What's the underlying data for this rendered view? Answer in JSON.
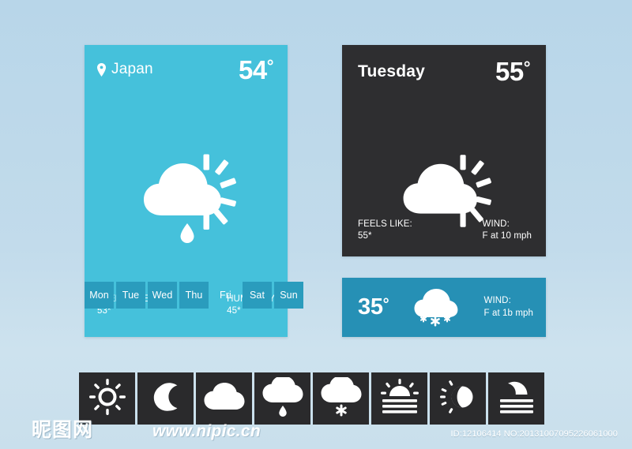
{
  "background": {
    "top_color": "#b8d6e9",
    "bottom_color": "#cde2ee"
  },
  "main_card": {
    "accent_color": "#45c1db",
    "location_icon": "location-pin-icon",
    "location": "Japan",
    "temperature": "54",
    "degree": "°",
    "weather_icon": "cloud-sun-rain-icon",
    "feels_like_label": "FEELS LIKE:",
    "feels_like_value": "53*",
    "humidity_label": "HUMANITY",
    "humidity_value": "45*",
    "days": [
      {
        "label": "Mon",
        "selected": false
      },
      {
        "label": "Tue",
        "selected": false
      },
      {
        "label": "Wed",
        "selected": false
      },
      {
        "label": "Thu",
        "selected": false
      },
      {
        "label": "Fri",
        "selected": true
      },
      {
        "label": "Sat",
        "selected": false
      },
      {
        "label": "Sun",
        "selected": false
      }
    ]
  },
  "dark_card": {
    "accent_color": "#2e2e30",
    "day": "Tuesday",
    "temperature": "55",
    "degree": "°",
    "weather_icon": "cloud-sun-icon",
    "feels_like_label": "FEELS LIKE:",
    "feels_like_value": "55*",
    "wind_label": "WIND:",
    "wind_value": "F at 10 mph"
  },
  "teal_card": {
    "accent_color": "#2690b5",
    "temperature": "35",
    "degree": "°",
    "weather_icon": "cloud-snow-icon",
    "wind_label": "WIND:",
    "wind_value": "F at 1b mph"
  },
  "icon_strip": {
    "background_color": "#2a2a2c",
    "icons": [
      {
        "name": "sun-icon"
      },
      {
        "name": "moon-icon"
      },
      {
        "name": "cloud-icon"
      },
      {
        "name": "cloud-rain-icon"
      },
      {
        "name": "cloud-snow-icon"
      },
      {
        "name": "sunrise-icon"
      },
      {
        "name": "sun-eclipse-icon"
      },
      {
        "name": "moonset-icon"
      }
    ]
  },
  "footer": {
    "watermark_cn": "昵图网",
    "watermark_url": "www.nipic.cn",
    "id_text": "ID:12106414 NO:20131007095226061000"
  }
}
